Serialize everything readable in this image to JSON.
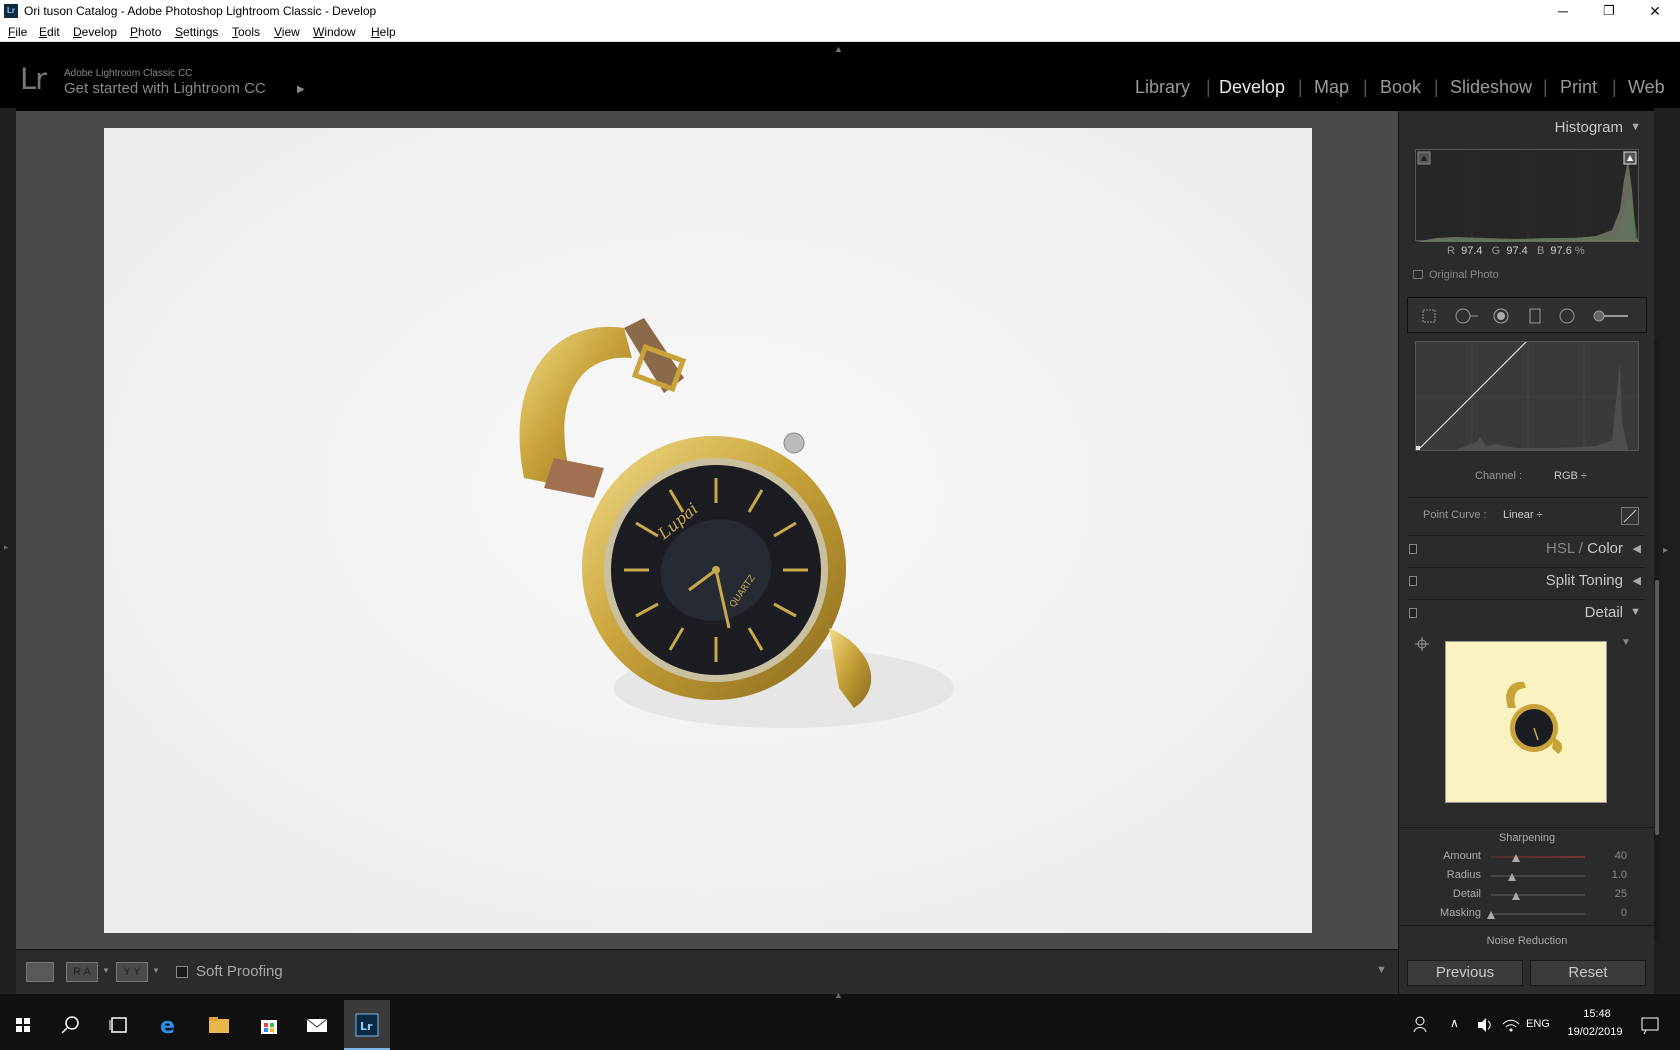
{
  "window": {
    "title": "Ori tuson Catalog - Adobe Photoshop Lightroom Classic - Develop",
    "app_icon": "Lr",
    "minimize_icon": "─",
    "restore_icon": "❐",
    "close_icon": "✕"
  },
  "menu": [
    "File",
    "Edit",
    "Develop",
    "Photo",
    "Settings",
    "Tools",
    "View",
    "Window",
    "Help"
  ],
  "identity": {
    "logo": "Lr",
    "app_name": "Adobe Lightroom Classic CC",
    "get_started": "Get started with Lightroom CC",
    "arrow": "▶"
  },
  "modules": [
    {
      "label": "Library",
      "active": false
    },
    {
      "label": "Develop",
      "active": true
    },
    {
      "label": "Map",
      "active": false
    },
    {
      "label": "Book",
      "active": false
    },
    {
      "label": "Slideshow",
      "active": false
    },
    {
      "label": "Print",
      "active": false
    },
    {
      "label": "Web",
      "active": false
    }
  ],
  "photo": {
    "dial_brand": "Lupai",
    "dial_text": "QUARTZ"
  },
  "toolbar": {
    "soft_proofing": "Soft Proofing",
    "view_loupe": "",
    "view_ra": "R A",
    "view_yy": "Y Y",
    "dropdown": "▼"
  },
  "histogram": {
    "title": "Histogram",
    "collapse_icon": "▼",
    "r_label": "R",
    "r_value": "97.4",
    "g_label": "G",
    "g_value": "97.4",
    "b_label": "B",
    "b_value": "97.6",
    "unit": "%",
    "original_photo": "Original Photo"
  },
  "tone_curve": {
    "channel_label": "Channel :",
    "channel_value": "RGB ÷",
    "point_curve_label": "Point Curve :",
    "point_curve_value": "Linear ÷"
  },
  "panels": {
    "hsl_title_a": "HSL",
    "hsl_title_sep": " / ",
    "hsl_title_b": "Color",
    "split_toning": "Split Toning",
    "detail": "Detail",
    "collapsed_icon": "◀",
    "expanded_icon": "▼"
  },
  "sharpening": {
    "title": "Sharpening",
    "sliders": [
      {
        "label": "Amount",
        "value": "40",
        "position": 0.27
      },
      {
        "label": "Radius",
        "value": "1.0",
        "position": 0.22
      },
      {
        "label": "Detail",
        "value": "25",
        "position": 0.27
      },
      {
        "label": "Masking",
        "value": "0",
        "position": 0.0
      }
    ]
  },
  "noise_reduction": "Noise Reduction",
  "buttons": {
    "previous": "Previous",
    "reset": "Reset"
  },
  "taskbar": {
    "language": "ENG",
    "time": "15:48",
    "date": "19/02/2019",
    "lr_icon": "Lr"
  },
  "colors": {
    "accent_blue": "#7fb5e6",
    "gold": "#d4b54a",
    "dial": "#1b1d22"
  }
}
